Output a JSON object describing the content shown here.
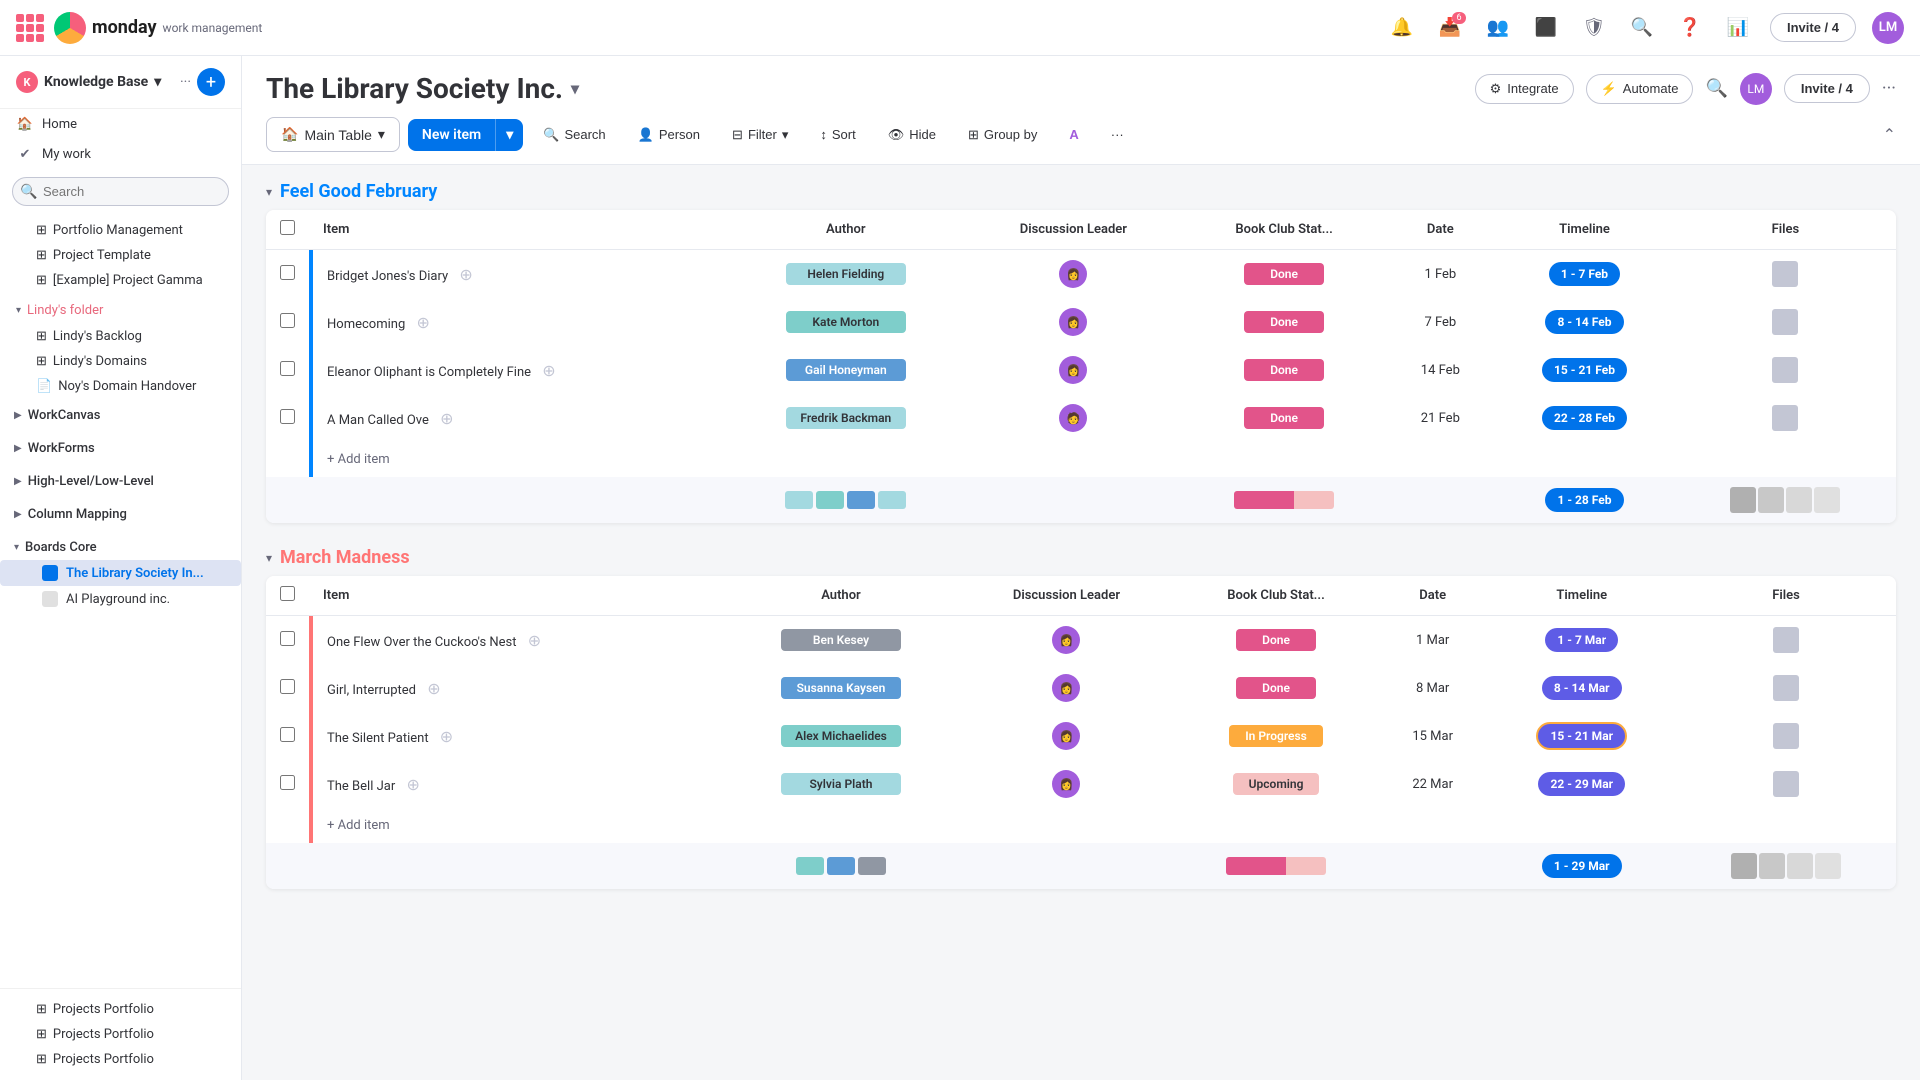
{
  "topnav": {
    "brand": "monday",
    "brand_sub": "work management",
    "notifications_icon": "🔔",
    "inbox_icon": "📥",
    "inbox_badge": "6",
    "people_icon": "👥",
    "apps_icon": "⬛",
    "admin_icon": "🛡",
    "search_icon": "🔍",
    "help_icon": "?",
    "analytics_icon": "📊",
    "invite_label": "Invite / 4",
    "avatar_initials": "LM"
  },
  "sidebar": {
    "workspace_name": "Knowledge Base",
    "home_label": "Home",
    "mywork_label": "My work",
    "search_placeholder": "Search",
    "nav_items": [
      {
        "id": "portfolio-mgmt",
        "label": "Portfolio Management",
        "icon": "⊞"
      },
      {
        "id": "project-template",
        "label": "Project Template",
        "icon": "⊞"
      },
      {
        "id": "example-gamma",
        "label": "[Example] Project Gamma",
        "icon": "⊞"
      }
    ],
    "folder_name": "Lindy's folder",
    "folder_items": [
      {
        "id": "lindys-backlog",
        "label": "Lindy's Backlog",
        "icon": "⊞"
      },
      {
        "id": "lindys-domains",
        "label": "Lindy's Domains",
        "icon": "⊞"
      },
      {
        "id": "noys-domain",
        "label": "Noy's Domain Handover",
        "icon": "📄"
      }
    ],
    "collapsed_groups": [
      {
        "id": "workcanvas",
        "label": "WorkCanvas"
      },
      {
        "id": "workforms",
        "label": "WorkForms"
      },
      {
        "id": "highlevel",
        "label": "High-Level/Low-Level"
      },
      {
        "id": "column-mapping",
        "label": "Column Mapping"
      }
    ],
    "boards_core": {
      "label": "Boards Core",
      "items": [
        {
          "id": "library-society",
          "label": "The Library Society In...",
          "active": true,
          "icon": "board"
        },
        {
          "id": "ai-playground",
          "label": "AI Playground inc.",
          "active": false,
          "icon": "board"
        }
      ]
    },
    "bottom_items": [
      {
        "id": "projects-portfolio-1",
        "label": "Projects Portfolio"
      },
      {
        "id": "projects-portfolio-2",
        "label": "Projects Portfolio"
      },
      {
        "id": "projects-portfolio-3",
        "label": "Projects Portfolio"
      }
    ]
  },
  "board": {
    "title": "The Library Society Inc.",
    "integrate_label": "Integrate",
    "automate_label": "Automate",
    "invite_label": "Invite / 4",
    "toolbar": {
      "main_table_label": "Main Table",
      "new_item_label": "New item",
      "search_label": "Search",
      "person_label": "Person",
      "filter_label": "Filter",
      "sort_label": "Sort",
      "hide_label": "Hide",
      "group_by_label": "Group by"
    },
    "groups": [
      {
        "id": "feel-good-feb",
        "title": "Feel Good February",
        "color": "#0085ff",
        "columns": [
          "Item",
          "Author",
          "Discussion Leader",
          "Book Club Stat...",
          "Date",
          "Timeline",
          "Files"
        ],
        "rows": [
          {
            "item": "Bridget Jones's Diary",
            "author": "Helen Fielding",
            "author_color": "author-blue",
            "disc_leader": "DL",
            "status": "Done",
            "status_class": "status-done",
            "date": "1 Feb",
            "timeline": "1 - 7 Feb",
            "timeline_class": "timeline-feb"
          },
          {
            "item": "Homecoming",
            "author": "Kate Morton",
            "author_color": "author-mid",
            "disc_leader": "DL",
            "status": "Done",
            "status_class": "status-done",
            "date": "7 Feb",
            "timeline": "8 - 14 Feb",
            "timeline_class": "timeline-feb"
          },
          {
            "item": "Eleanor Oliphant is Completely Fine",
            "author": "Gail Honeyman",
            "author_color": "author-dark",
            "disc_leader": "DL",
            "status": "Done",
            "status_class": "status-done",
            "date": "14 Feb",
            "timeline": "15 - 21 Feb",
            "timeline_class": "timeline-feb"
          },
          {
            "item": "A Man Called Ove",
            "author": "Fredrik Backman",
            "author_color": "author-blue",
            "disc_leader": "DL2",
            "status": "Done",
            "status_class": "status-done",
            "date": "21 Feb",
            "timeline": "22 - 28 Feb",
            "timeline_class": "timeline-feb"
          }
        ],
        "summary_timeline": "1 - 28 Feb",
        "summary_bars": [
          "#a3d9e0",
          "#7ececa",
          "#5c9bd6",
          "#a3d9e0"
        ]
      },
      {
        "id": "march-madness",
        "title": "March Madness",
        "color": "#ff7575",
        "columns": [
          "Item",
          "Author",
          "Discussion Leader",
          "Book Club Stat...",
          "Date",
          "Timeline",
          "Files"
        ],
        "rows": [
          {
            "item": "One Flew Over the Cuckoo's Nest",
            "author": "Ben Kesey",
            "author_color": "author-gray",
            "disc_leader": "DL",
            "status": "Done",
            "status_class": "status-done",
            "date": "1 Mar",
            "timeline": "1 - 7 Mar",
            "timeline_class": "timeline-mar"
          },
          {
            "item": "Girl, Interrupted",
            "author": "Susanna Kaysen",
            "author_color": "author-dark",
            "disc_leader": "DL",
            "status": "Done",
            "status_class": "status-done",
            "date": "8 Mar",
            "timeline": "8 - 14 Mar",
            "timeline_class": "timeline-mar"
          },
          {
            "item": "The Silent Patient",
            "author": "Alex Michaelides",
            "author_color": "author-mid",
            "disc_leader": "DL",
            "status": "In Progress",
            "status_class": "status-inprogress",
            "date": "15 Mar",
            "timeline": "15 - 21 Mar",
            "timeline_class": "timeline-mar-inprogress"
          },
          {
            "item": "The Bell Jar",
            "author": "Sylvia Plath",
            "author_color": "author-blue",
            "disc_leader": "DL",
            "status": "Upcoming",
            "status_class": "status-upcoming",
            "date": "22 Mar",
            "timeline": "22 - 29 Mar",
            "timeline_class": "timeline-mar"
          }
        ],
        "summary_timeline": "1 - 29 Mar",
        "summary_bars": [
          "#7ececa",
          "#5c9bd6",
          "#9097a3"
        ]
      }
    ],
    "add_item_label": "+ Add item"
  }
}
